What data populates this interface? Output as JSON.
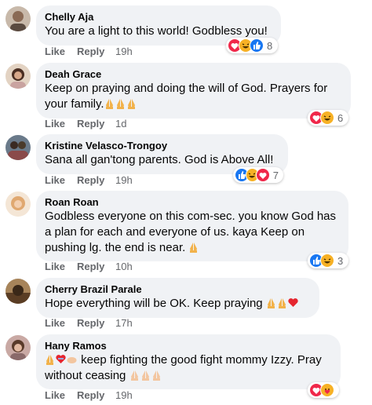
{
  "actions": {
    "like_label": "Like",
    "reply_label": "Reply"
  },
  "comments": [
    {
      "author": "Chelly Aja",
      "lines": [
        "You are a light to this world! Godbless you!"
      ],
      "time": "19h",
      "reactions": [
        "love",
        "haha",
        "like"
      ],
      "reaction_count": "8",
      "avatar_color": "#b9a89a"
    },
    {
      "author": "Deah Grace",
      "lines": [
        "Keep on praying and doing the will of God. Prayers for",
        "your family."
      ],
      "time": "1d",
      "reactions": [
        "love",
        "haha"
      ],
      "reaction_count": "6",
      "avatar_color": "#6b4a3a"
    },
    {
      "author": "Kristine Velasco-Trongoy",
      "lines": [
        "Sana all gan'tong parents. God is Above All!"
      ],
      "time": "19h",
      "reactions": [
        "like",
        "haha",
        "love"
      ],
      "reaction_count": "7",
      "avatar_color": "#4a5a6a"
    },
    {
      "author": "Roan Roan",
      "lines": [
        "Godbless everyone on this com-sec. you know God has",
        "a plan for each and everyone of us. kaya Keep on",
        "pushing lg. the end is near."
      ],
      "time": "10h",
      "reactions": [
        "like",
        "haha"
      ],
      "reaction_count": "3",
      "avatar_color": "#d9b48a"
    },
    {
      "author": "Cherry Brazil Parale",
      "lines": [
        "Hope everything will be OK. Keep praying"
      ],
      "time": "17h",
      "reactions": [],
      "reaction_count": "",
      "avatar_color": "#7a5a3a"
    },
    {
      "author": "Hany Ramos",
      "lines": [
        "keep fighting the good fight mommy Izzy. Pray",
        "without ceasing"
      ],
      "time": "19h",
      "reactions": [
        "love",
        "care"
      ],
      "reaction_count": "",
      "avatar_color": "#a87a7a"
    }
  ],
  "colors": {
    "bubble": "#f0f2f5",
    "meta": "#65676b",
    "love": "#f0284a",
    "like": "#1877f2",
    "haha": "#f7b125"
  },
  "icons": [
    "folded-hands-icon",
    "red-heart-icon",
    "love-reaction-icon",
    "haha-reaction-icon",
    "like-reaction-icon",
    "care-reaction-icon"
  ]
}
